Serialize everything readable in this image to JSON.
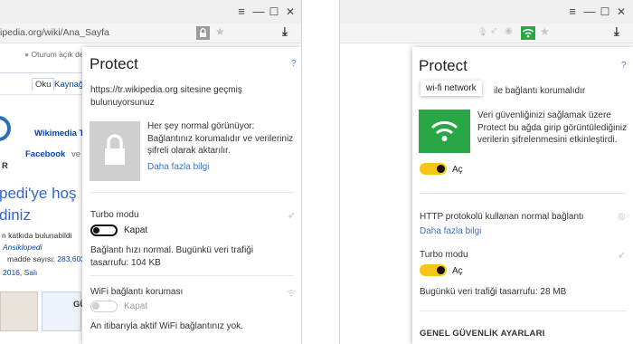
{
  "left": {
    "url": "ipedia.org/wiki/Ana_Sayfa",
    "page": {
      "user_text": "Oturum açık de",
      "tab_read": "Oku",
      "tab_source": "Kaynağ",
      "portal_title": "Wikimedia T",
      "social": "Facebook",
      "social_suffix": "ve",
      "letter_r": "R",
      "headline1": "pedi'ye hoş",
      "headline2": "diniz",
      "line1": "n katkıda bulunabildi",
      "line2": "Ansiklopedi",
      "line3_prefix": "madde sayısı:",
      "line3_value": "283.603",
      "line4": "2016, Salı",
      "gu_text": "GÜ"
    },
    "popup": {
      "title": "Protect",
      "help": "?",
      "site_msg": "https://tr.wikipedia.org sitesine geçmiş bulunuyorsunuz",
      "status_text": "Her şey normal görünüyor: Bağlantınız korumalıdır ve verileriniz şifreli olarak aktarılır.",
      "more_link": "Daha fazla bilgi",
      "turbo_title": "Turbo modu",
      "turbo_state": "Kapat",
      "turbo_desc": "Bağlantı hızı normal. Bugünkü veri trafiği tasarrufu: 104 KB",
      "wifi_title": "WiFi bağlantı koruması",
      "wifi_state": "Kapat",
      "wifi_desc": "An itibarıyla aktif WiFi bağlantınız yok."
    }
  },
  "right": {
    "popup": {
      "title": "Protect",
      "help": "?",
      "tooltip": "wi-fi network",
      "subtitle_rest": "ile bağlantı korumalıdır",
      "wifi_desc": "Veri güvenliğinizi sağlamak üzere Protect bu ağda girip görüntülediğiniz verilerin şifrelenmesini etkinleştirdi.",
      "wifi_state": "Aç",
      "http_title": "HTTP protokolü kullanan normal bağlantı",
      "more_link": "Daha fazla bilgi",
      "turbo_title": "Turbo modu",
      "turbo_state": "Aç",
      "turbo_desc": "Bugünkü veri trafiği tasarrufu: 28 MB",
      "general_settings": "GENEL GÜVENLİK AYARLARI"
    }
  },
  "window_controls": {
    "menu": "≡",
    "minimize": "—",
    "maximize": "☐",
    "close": "✕"
  },
  "icons": {
    "star": "★",
    "download": "⤓",
    "help": "?"
  },
  "colors": {
    "accent_green": "#29a745",
    "toggle_yellow": "#f5c518",
    "link_blue": "#3a71c1",
    "wiki_blue": "#0645ad"
  }
}
